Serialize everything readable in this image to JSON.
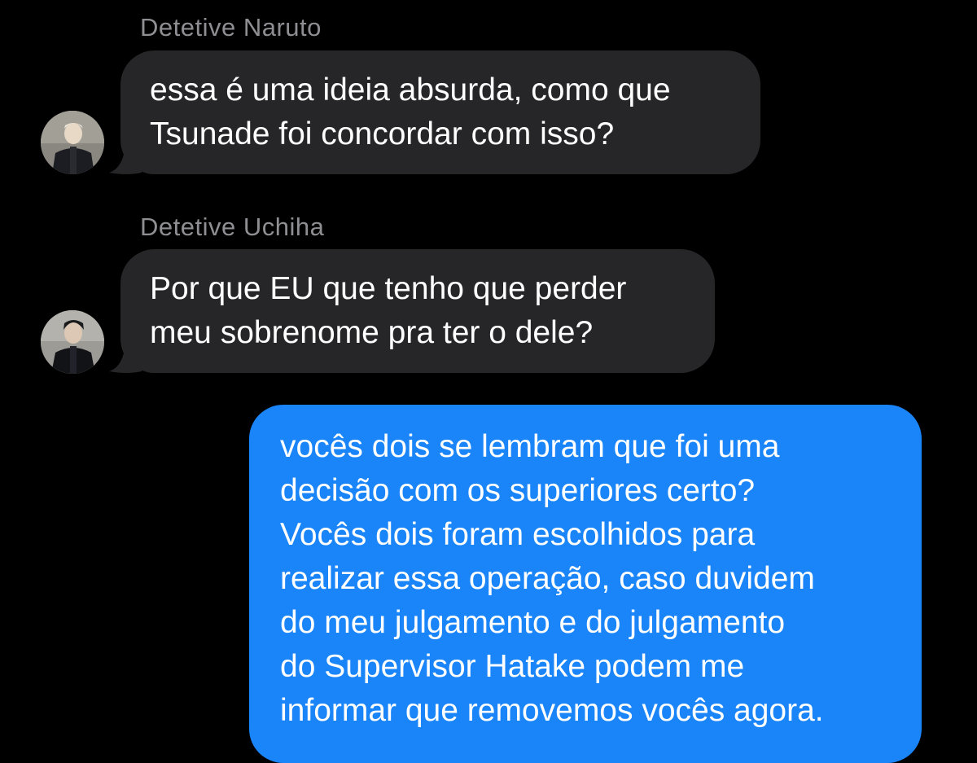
{
  "messages": [
    {
      "sender": "Detetive Naruto",
      "direction": "incoming",
      "text": "essa é uma ideia absurda, como que\nTsunade foi concordar com isso?"
    },
    {
      "sender": "Detetive Uchiha",
      "direction": "incoming",
      "text": "Por que EU que tenho que perder\nmeu sobrenome pra ter o dele?"
    },
    {
      "sender": "",
      "direction": "outgoing",
      "text": "vocês dois se lembram que foi uma\ndecisão com os superiores certo?\nVocês dois foram escolhidos para\nrealizar essa operação, caso duvidem\ndo meu julgamento e do julgamento\ndo Supervisor Hatake podem me\ninformar que removemos vocês agora."
    }
  ],
  "colors": {
    "background": "#000000",
    "incoming_bubble": "#262628",
    "outgoing_bubble": "#1a84f9",
    "sender_name": "#8e8e93",
    "text": "#ffffff"
  }
}
